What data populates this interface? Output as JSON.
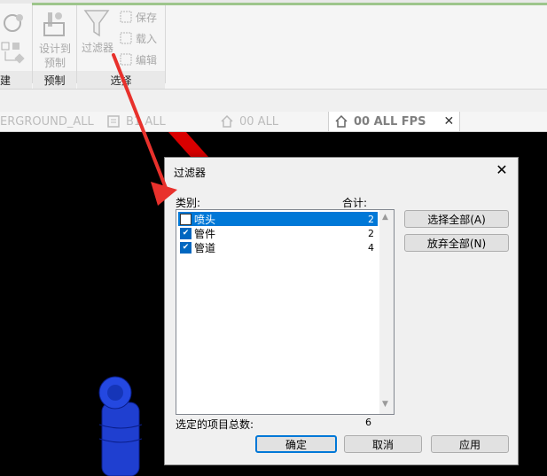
{
  "ribbon": {
    "panels": [
      {
        "label": "建"
      },
      {
        "label": "预制"
      },
      {
        "label": "选择"
      }
    ],
    "design_to_prefab_label": "设计到\n预制",
    "filter_label": "过滤器",
    "save_label": "保存",
    "load_label": "载入",
    "edit_label": "编辑"
  },
  "tabs": [
    {
      "label": "ERGROUND_ALL"
    },
    {
      "label": "B1 ALL"
    },
    {
      "label": "00 ALL"
    },
    {
      "label": "00 ALL FPS",
      "active": true
    }
  ],
  "dialog": {
    "title": "过滤器",
    "category_header": "类别:",
    "total_header": "合计:",
    "rows": [
      {
        "label": "喷头",
        "count": "2",
        "checked": false,
        "selected": true
      },
      {
        "label": "管件",
        "count": "2",
        "checked": true,
        "selected": false
      },
      {
        "label": "管道",
        "count": "4",
        "checked": true,
        "selected": false
      }
    ],
    "select_all": "选择全部(A)",
    "discard_all": "放弃全部(N)",
    "total_label": "选定的项目总数:",
    "total_value": "6",
    "ok": "确定",
    "cancel": "取消",
    "apply": "应用"
  },
  "colors": {
    "accent": "#0078d7",
    "pipe_red": "#d90000",
    "pipe_blue": "#1f3fd0",
    "annotation_arrow": "#e8312c"
  }
}
